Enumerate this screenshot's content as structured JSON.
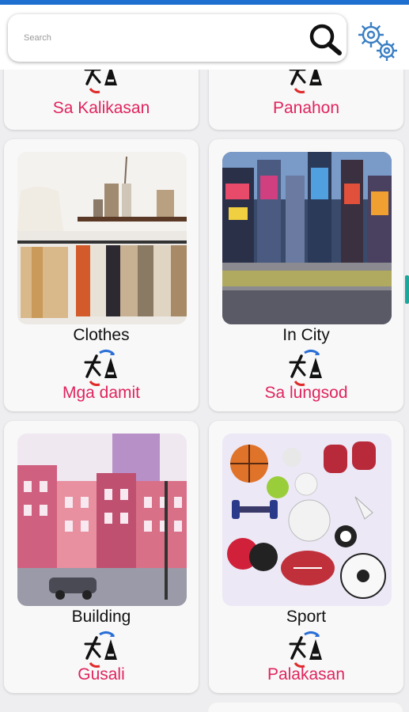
{
  "search": {
    "placeholder": "Search"
  },
  "categories": [
    {
      "english": "",
      "tagalog": "Sa Kalikasan"
    },
    {
      "english": "",
      "tagalog": "Panahon"
    },
    {
      "english": "Clothes",
      "tagalog": "Mga damit"
    },
    {
      "english": "In City",
      "tagalog": "Sa lungsod"
    },
    {
      "english": "Building",
      "tagalog": "Gusali"
    },
    {
      "english": "Sport",
      "tagalog": "Palakasan"
    }
  ],
  "colors": {
    "accent": "#e0245e",
    "statusbar": "#1f6fd0",
    "gear": "#3b7fc4"
  },
  "icons": [
    "search-icon",
    "gear-icon",
    "translate-logo-icon"
  ]
}
